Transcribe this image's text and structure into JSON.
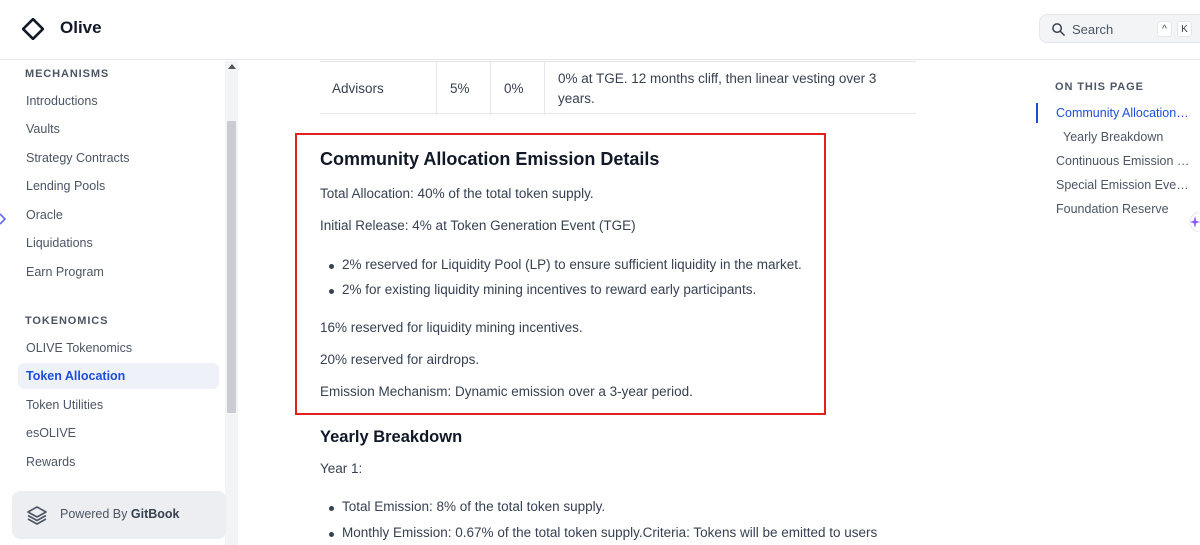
{
  "header": {
    "brand": "Olive",
    "search_label": "Search",
    "shortcut_keys": [
      "^",
      "K"
    ]
  },
  "sidebar": {
    "section_mechanisms": "MECHANISMS",
    "mechanisms": [
      {
        "label": "Introductions"
      },
      {
        "label": "Vaults"
      },
      {
        "label": "Strategy Contracts"
      },
      {
        "label": "Lending Pools"
      },
      {
        "label": "Oracle"
      },
      {
        "label": "Liquidations"
      },
      {
        "label": "Earn Program"
      }
    ],
    "section_tokenomics": "TOKENOMICS",
    "tokenomics": [
      {
        "label": "OLIVE Tokenomics"
      },
      {
        "label": "Token Allocation",
        "active": true
      },
      {
        "label": "Token Utilities"
      },
      {
        "label": "esOLIVE"
      },
      {
        "label": "Rewards"
      }
    ],
    "powered_prefix": "Powered By",
    "powered_brand": "GitBook"
  },
  "table": {
    "row": {
      "name": "Advisors",
      "col2": "5%",
      "col3": "0%",
      "vesting_line1": "0% at TGE. 12 months cliff, then linear vesting over 3",
      "vesting_line2": "years."
    }
  },
  "content": {
    "heading": "Community Allocation Emission Details",
    "total_allocation": "Total Allocation: 40% of the total token supply.",
    "initial_release": "Initial Release: 4% at Token Generation Event (TGE)",
    "bullets": [
      "2% reserved for Liquidity Pool (LP) to ensure sufficient liquidity in the market.",
      "2% for existing liquidity mining incentives to reward early participants."
    ],
    "liquidity_mining": "16% reserved for liquidity mining incentives.",
    "airdrops": "20% reserved for airdrops.",
    "emission_mechanism": "Emission Mechanism: Dynamic emission over a 3-year period.",
    "yearly_heading": "Yearly Breakdown",
    "year1": "Year 1:",
    "year1_bullets": [
      "Total Emission: 8% of the total token supply.",
      "Monthly Emission: 0.67% of the total token supply.Criteria: Tokens will be emitted to users"
    ]
  },
  "toc": {
    "title": "ON THIS PAGE",
    "items": [
      {
        "label": "Community Allocation ...",
        "active": true
      },
      {
        "label": "Yearly Breakdown"
      },
      {
        "label": "Continuous Emission R..."
      },
      {
        "label": "Special Emission Events:"
      },
      {
        "label": "Foundation Reserve"
      }
    ]
  },
  "colors": {
    "accent": "#1d4ed8",
    "highlight_border": "#e32020",
    "sparkle": "#8b5cf6"
  }
}
